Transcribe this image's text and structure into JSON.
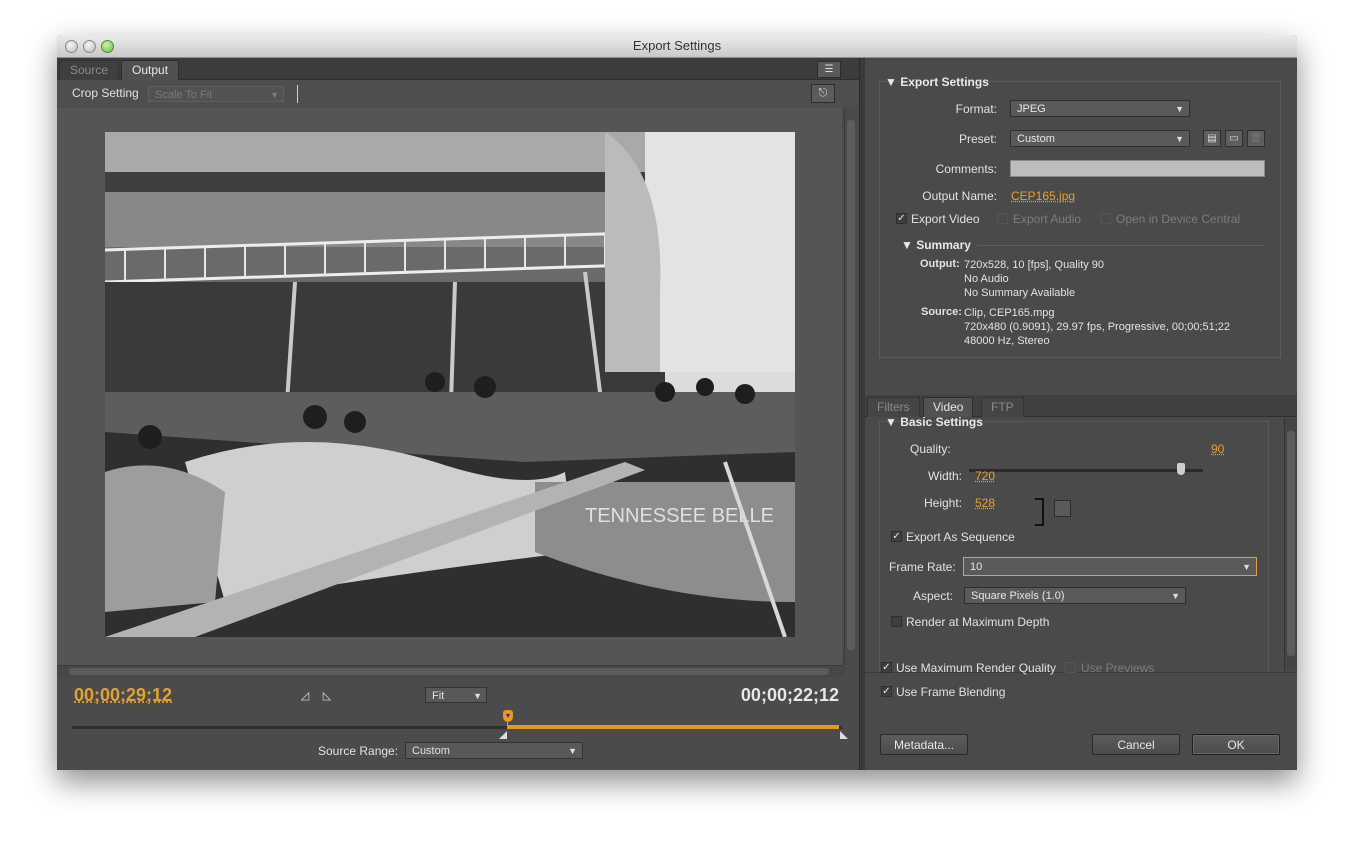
{
  "window": {
    "title": "Export Settings"
  },
  "left_tabs": [
    {
      "label": "Source",
      "active": false
    },
    {
      "label": "Output",
      "active": true
    }
  ],
  "crop": {
    "label": "Crop Setting",
    "value": "Scale To Fit"
  },
  "playback": {
    "current_timecode": "00;00;29;12",
    "duration_timecode": "00;00;22;12",
    "zoom": "Fit",
    "source_range_label": "Source Range:",
    "source_range_value": "Custom",
    "range_start_fraction": 0.565,
    "playhead_fraction": 0.565
  },
  "export_settings": {
    "section": "Export Settings",
    "format_label": "Format:",
    "format": "JPEG",
    "preset_label": "Preset:",
    "preset": "Custom",
    "comments_label": "Comments:",
    "comments": "",
    "output_name_label": "Output Name:",
    "output_name": "CEP165.jpg",
    "export_video_label": "Export Video",
    "export_video": true,
    "export_audio_label": "Export Audio",
    "open_device_central_label": "Open in Device Central"
  },
  "summary": {
    "section": "Summary",
    "output_key": "Output:",
    "output_lines": [
      "720x528, 10 [fps], Quality 90",
      "No Audio",
      "No Summary Available"
    ],
    "source_key": "Source:",
    "source_lines": [
      "Clip, CEP165.mpg",
      "720x480 (0.9091), 29.97 fps, Progressive, 00;00;51;22",
      "48000 Hz, Stereo"
    ]
  },
  "right_tabs": [
    {
      "label": "Filters",
      "active": false
    },
    {
      "label": "Video",
      "active": true
    },
    {
      "label": "FTP",
      "active": false
    }
  ],
  "basic_settings": {
    "section": "Basic Settings",
    "quality_label": "Quality:",
    "quality": "90",
    "quality_fraction": 0.9,
    "width_label": "Width:",
    "width": "720",
    "height_label": "Height:",
    "height": "528",
    "export_sequence_label": "Export As Sequence",
    "export_sequence": true,
    "frame_rate_label": "Frame Rate:",
    "frame_rate": "10",
    "aspect_label": "Aspect:",
    "aspect": "Square Pixels (1.0)",
    "render_max_depth_label": "Render at Maximum Depth",
    "render_max_depth": false
  },
  "bottom_options": {
    "max_render_quality_label": "Use Maximum Render Quality",
    "max_render_quality": true,
    "use_previews_label": "Use Previews",
    "use_previews": false,
    "frame_blending_label": "Use Frame Blending",
    "frame_blending": true
  },
  "buttons": {
    "metadata": "Metadata...",
    "cancel": "Cancel",
    "ok": "OK"
  },
  "colors": {
    "accent": "#e5a22a",
    "panel": "#4a4a4a"
  }
}
